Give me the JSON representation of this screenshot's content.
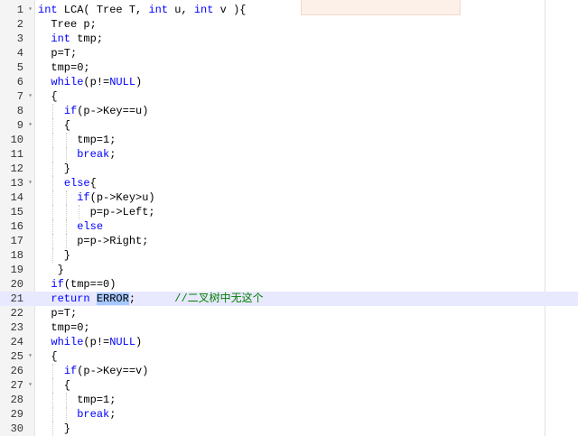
{
  "colors": {
    "keyword": "#0000ff",
    "comment": "#008000",
    "selection": "#a6c8ff"
  },
  "lines": [
    {
      "n": "1",
      "fold": "▾",
      "guides": [],
      "segs": [
        {
          "t": "int",
          "c": "kw"
        },
        {
          "t": " LCA( Tree T, "
        },
        {
          "t": "int",
          "c": "kw"
        },
        {
          "t": " u, "
        },
        {
          "t": "int",
          "c": "kw"
        },
        {
          "t": " v ){"
        }
      ]
    },
    {
      "n": "2",
      "fold": "",
      "guides": [],
      "segs": [
        {
          "t": "  Tree p;"
        }
      ]
    },
    {
      "n": "3",
      "fold": "",
      "guides": [],
      "segs": [
        {
          "t": "  "
        },
        {
          "t": "int",
          "c": "kw"
        },
        {
          "t": " tmp;"
        }
      ]
    },
    {
      "n": "4",
      "fold": "",
      "guides": [],
      "segs": [
        {
          "t": "  p=T;"
        }
      ]
    },
    {
      "n": "5",
      "fold": "",
      "guides": [],
      "segs": [
        {
          "t": "  tmp=0;"
        }
      ]
    },
    {
      "n": "6",
      "fold": "",
      "guides": [],
      "segs": [
        {
          "t": "  "
        },
        {
          "t": "while",
          "c": "kw"
        },
        {
          "t": "(p!="
        },
        {
          "t": "NULL",
          "c": "kw"
        },
        {
          "t": ")"
        }
      ]
    },
    {
      "n": "7",
      "fold": "▾",
      "guides": [],
      "segs": [
        {
          "t": "  {"
        }
      ]
    },
    {
      "n": "8",
      "fold": "",
      "guides": [
        2
      ],
      "segs": [
        {
          "t": "    "
        },
        {
          "t": "if",
          "c": "kw"
        },
        {
          "t": "(p->Key==u)"
        }
      ]
    },
    {
      "n": "9",
      "fold": "▾",
      "guides": [
        2
      ],
      "segs": [
        {
          "t": "    {"
        }
      ]
    },
    {
      "n": "10",
      "fold": "",
      "guides": [
        2,
        4
      ],
      "segs": [
        {
          "t": "      tmp=1;"
        }
      ]
    },
    {
      "n": "11",
      "fold": "",
      "guides": [
        2,
        4
      ],
      "segs": [
        {
          "t": "      "
        },
        {
          "t": "break",
          "c": "kw"
        },
        {
          "t": ";"
        }
      ]
    },
    {
      "n": "12",
      "fold": "",
      "guides": [
        2
      ],
      "segs": [
        {
          "t": "    }"
        }
      ]
    },
    {
      "n": "13",
      "fold": "▾",
      "guides": [
        2
      ],
      "segs": [
        {
          "t": "    "
        },
        {
          "t": "else",
          "c": "kw"
        },
        {
          "t": "{"
        }
      ]
    },
    {
      "n": "14",
      "fold": "",
      "guides": [
        2,
        4
      ],
      "segs": [
        {
          "t": "      "
        },
        {
          "t": "if",
          "c": "kw"
        },
        {
          "t": "(p->Key>u)"
        }
      ]
    },
    {
      "n": "15",
      "fold": "",
      "guides": [
        2,
        4,
        6
      ],
      "segs": [
        {
          "t": "        p=p->Left;"
        }
      ]
    },
    {
      "n": "16",
      "fold": "",
      "guides": [
        2,
        4
      ],
      "segs": [
        {
          "t": "      "
        },
        {
          "t": "else",
          "c": "kw"
        }
      ]
    },
    {
      "n": "17",
      "fold": "",
      "guides": [
        2,
        4
      ],
      "segs": [
        {
          "t": "      p=p->Right;"
        }
      ]
    },
    {
      "n": "18",
      "fold": "",
      "guides": [
        2
      ],
      "segs": [
        {
          "t": "    }"
        }
      ]
    },
    {
      "n": "19",
      "fold": "",
      "guides": [],
      "segs": [
        {
          "t": "   }"
        }
      ]
    },
    {
      "n": "20",
      "fold": "",
      "guides": [],
      "segs": [
        {
          "t": "  "
        },
        {
          "t": "if",
          "c": "kw"
        },
        {
          "t": "(tmp==0)"
        }
      ]
    },
    {
      "n": "21",
      "fold": "",
      "guides": [],
      "hl": true,
      "segs": [
        {
          "t": "  "
        },
        {
          "t": "return",
          "c": "kw"
        },
        {
          "t": " "
        },
        {
          "t": "ERROR",
          "c": "sel"
        },
        {
          "t": ";      "
        },
        {
          "t": "//二叉树中无这个",
          "c": "cm"
        }
      ]
    },
    {
      "n": "22",
      "fold": "",
      "guides": [],
      "segs": [
        {
          "t": "  p=T;"
        }
      ]
    },
    {
      "n": "23",
      "fold": "",
      "guides": [],
      "segs": [
        {
          "t": "  tmp=0;"
        }
      ]
    },
    {
      "n": "24",
      "fold": "",
      "guides": [],
      "segs": [
        {
          "t": "  "
        },
        {
          "t": "while",
          "c": "kw"
        },
        {
          "t": "(p!="
        },
        {
          "t": "NULL",
          "c": "kw"
        },
        {
          "t": ")"
        }
      ]
    },
    {
      "n": "25",
      "fold": "▾",
      "guides": [],
      "segs": [
        {
          "t": "  {"
        }
      ]
    },
    {
      "n": "26",
      "fold": "",
      "guides": [
        2
      ],
      "segs": [
        {
          "t": "    "
        },
        {
          "t": "if",
          "c": "kw"
        },
        {
          "t": "(p->Key==v)"
        }
      ]
    },
    {
      "n": "27",
      "fold": "▾",
      "guides": [
        2
      ],
      "segs": [
        {
          "t": "    {"
        }
      ]
    },
    {
      "n": "28",
      "fold": "",
      "guides": [
        2,
        4
      ],
      "segs": [
        {
          "t": "      tmp=1;"
        }
      ]
    },
    {
      "n": "29",
      "fold": "",
      "guides": [
        2,
        4
      ],
      "segs": [
        {
          "t": "      "
        },
        {
          "t": "break",
          "c": "kw"
        },
        {
          "t": ";"
        }
      ]
    },
    {
      "n": "30",
      "fold": "",
      "guides": [
        2
      ],
      "segs": [
        {
          "t": "    }"
        }
      ]
    }
  ]
}
